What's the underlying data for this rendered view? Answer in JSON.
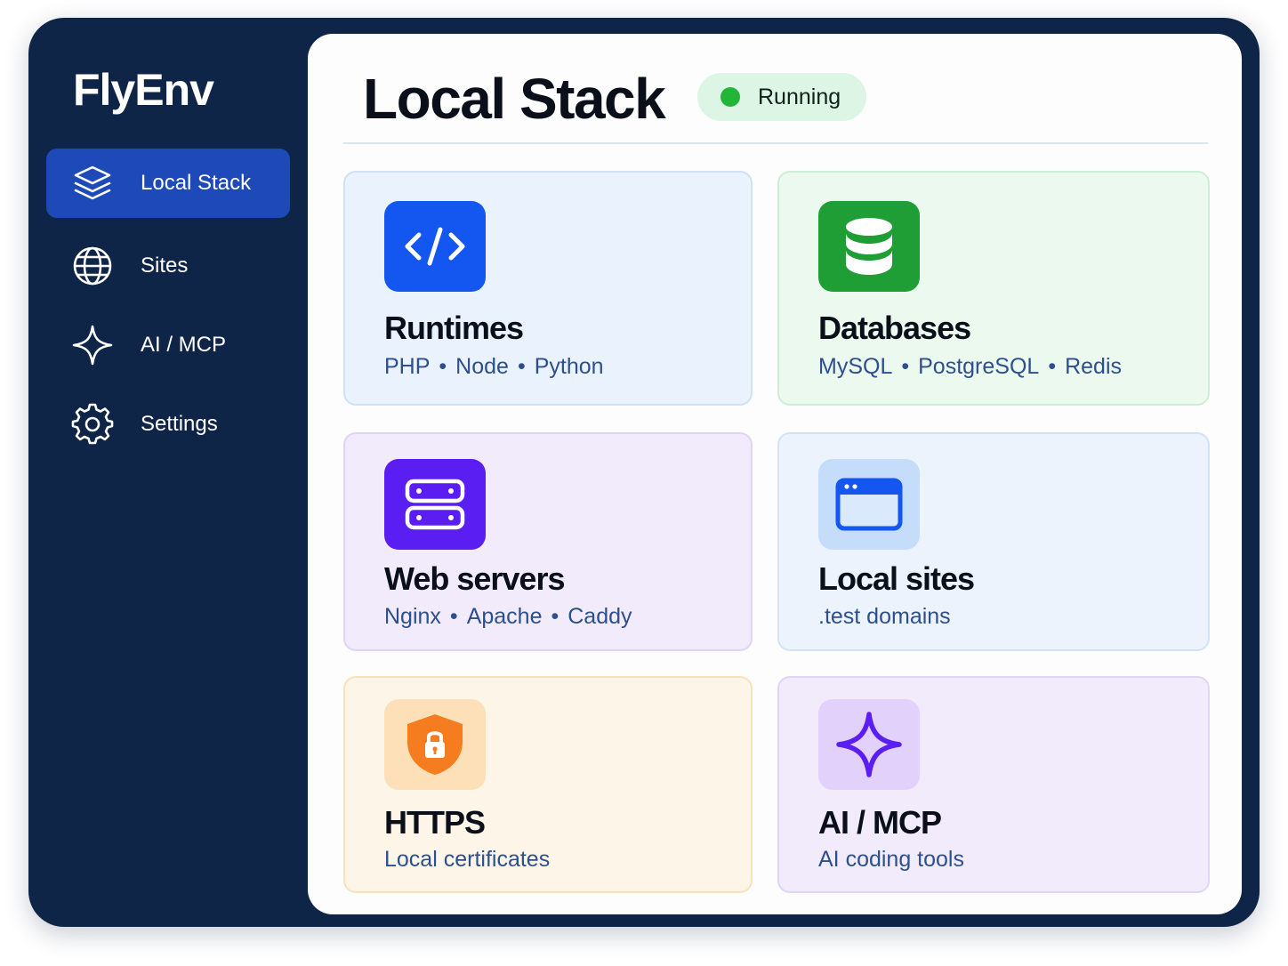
{
  "app": {
    "name": "FlyEnv"
  },
  "sidebar": {
    "items": [
      {
        "label": "Local Stack",
        "icon": "layers-icon",
        "active": true
      },
      {
        "label": "Sites",
        "icon": "globe-icon",
        "active": false
      },
      {
        "label": "AI / MCP",
        "icon": "sparkle-icon",
        "active": false
      },
      {
        "label": "Settings",
        "icon": "gear-icon",
        "active": false
      }
    ]
  },
  "header": {
    "title": "Local Stack",
    "status": {
      "label": "Running",
      "color": "#22b537"
    }
  },
  "cards": [
    {
      "title": "Runtimes",
      "icon": "code-icon",
      "color": "#1356f0",
      "tags": [
        "PHP",
        "Node",
        "Python"
      ]
    },
    {
      "title": "Databases",
      "icon": "database-icon",
      "color": "#1f9e35",
      "tags": [
        "MySQL",
        "PostgreSQL",
        "Redis"
      ]
    },
    {
      "title": "Web servers",
      "icon": "server-icon",
      "color": "#5b1ef2",
      "tags": [
        "Nginx",
        "Apache",
        "Caddy"
      ]
    },
    {
      "title": "Local sites",
      "icon": "browser-window-icon",
      "color": "#1356f0",
      "subtitle": ".test domains"
    },
    {
      "title": "HTTPS",
      "icon": "shield-lock-icon",
      "color": "#f57c1f",
      "subtitle": "Local certificates"
    },
    {
      "title": "AI / MCP",
      "icon": "sparkle-icon",
      "color": "#5b1ef2",
      "subtitle": "AI coding tools"
    }
  ]
}
